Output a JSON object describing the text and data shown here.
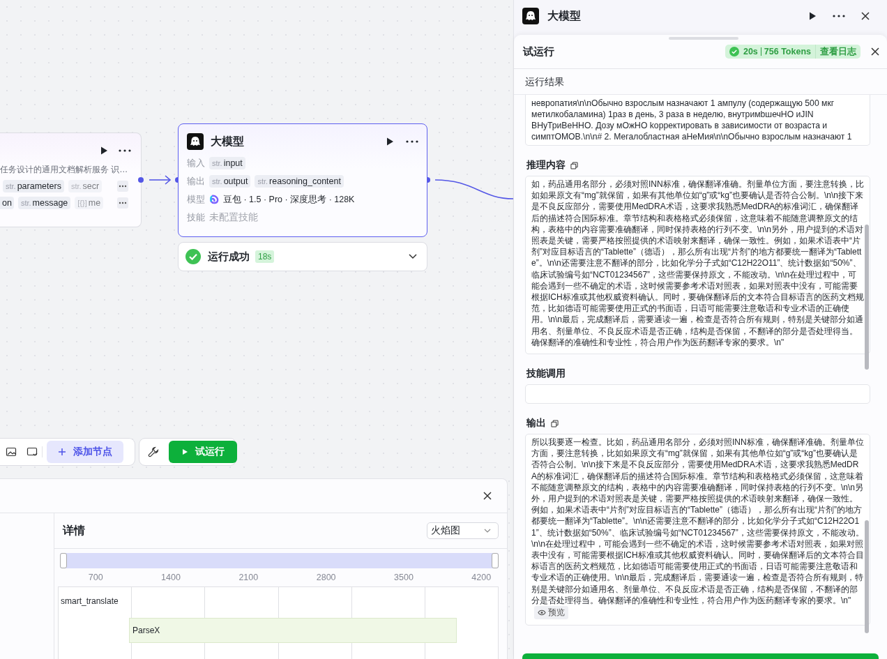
{
  "canvas": {
    "source_node": {
      "description": "任务设计的通用文档解析服务 识…",
      "port_rows": [
        [
          {
            "type": "str.",
            "name": "parameters",
            "faded": false
          },
          {
            "type": "str.",
            "name": "secr",
            "faded": true
          }
        ],
        [
          {
            "name": "on",
            "faded": false
          },
          {
            "type": "str.",
            "name": "message",
            "faded": false
          },
          {
            "type": "[{}]",
            "name": "me",
            "faded": true
          }
        ]
      ]
    },
    "llm_node": {
      "title": "大模型",
      "selected": true,
      "fields": [
        {
          "kind": "tags",
          "label": "输入",
          "tags": [
            {
              "type": "str.",
              "name": "input"
            }
          ]
        },
        {
          "kind": "tags",
          "label": "输出",
          "tags": [
            {
              "type": "str.",
              "name": "output"
            },
            {
              "type": "str.",
              "name": "reasoning_content"
            }
          ]
        },
        {
          "kind": "model",
          "label": "模型",
          "value": "豆包 · 1.5 · Pro · 深度思考 · 128K"
        },
        {
          "kind": "empty",
          "label": "技能",
          "value": "未配置技能"
        }
      ]
    },
    "run_status": {
      "text": "运行成功",
      "duration": "18s"
    },
    "toolbar": {
      "add_node": "添加节点",
      "test_run": "试运行"
    }
  },
  "trace_panel": {
    "title": "详情",
    "view_select": "火焰图",
    "range": {
      "level": 1
    },
    "ticks": [
      "700",
      "1400",
      "2100",
      "2800",
      "3500",
      "4200"
    ],
    "row_label": "smart_translate",
    "span_label": "ParseX"
  },
  "side_panel": {
    "title": "大模型",
    "test_run": {
      "title": "试运行",
      "time": "20s",
      "tokens": "756 Tokens",
      "log_link": "查看日志",
      "result_title": "运行结果",
      "result_lines": [
        "невропатия\\n\\nОбычно взрослым назначают 1 ампулу (содержащую 500 мкг",
        "метилкобаламина) 1раз в день, 3 раза в неделю, внутримbшечНО иJIN",
        "ВНуТриВеННО. Дозу мОжНО kорректировать в зависимости от возраста и",
        "симптОМОВ.\\n\\n# 2. Мегалобластная аНеМия\\n\\nОбычно взрослым назначают 1"
      ],
      "sections": [
        {
          "kind": "text",
          "title": "推理内容",
          "text": "如，药品通用名部分，必须对照INN标准，确保翻译准确。剂量单位方面，要注意转换，比如如果原文有“mg”就保留，如果有其他单位如“g”或“kg”也要确认是否符合公制。\\n\\n接下来是不良反应部分，需要使用MedDRA术语，这要求我熟悉MedDRA的标准词汇，确保翻译后的描述符合国际标准。章节结构和表格格式必须保留，这意味着不能随意调整原文的结构，表格中的内容需要准确翻译，同时保持表格的行列不变。\\n\\n另外，用户提到的术语对照表是关键，需要严格按照提供的术语映射来翻译，确保一致性。例如，如果术语表中“片剂”对应目标语言的“Tablette”（德语），那么所有出现“片剂”的地方都要统一翻译为“Tablette”。\\n\\n还需要注意不翻译的部分，比如化学分子式如“C12H22O11”、统计数据如“50%”、临床试验编号如“NCT01234567”，这些需要保持原文，不能改动。\\n\\n在处理过程中，可能会遇到一些不确定的术语，这时候需要参考术语对照表，如果对照表中没有，可能需要根据ICH标准或其他权威资料确认。同时，要确保翻译后的文本符合目标语言的医药文档规范，比如德语可能需要使用正式的书面语，日语可能需要注意敬语和专业术语的正确使用。\\n\\n最后，完成翻译后，需要通读一遍，检查是否符合所有规则，特别是关键部分如通用名、剂量单位、不良反应术语是否正确，结构是否保留，不翻译的部分是否处理得当。确保翻译的准确性和专业性，符合用户作为医药翻译专家的要求。\\n\""
        },
        {
          "kind": "empty",
          "title": "技能调用"
        },
        {
          "kind": "text",
          "title": "输出",
          "preview": "预览",
          "text": "所以我要逐一检查。比如，药品通用名部分，必须对照INN标准，确保翻译准确。剂量单位方面，要注意转换，比如如果原文有“mg”就保留，如果有其他单位如“g”或“kg”也要确认是否符合公制。\\n\\n接下来是不良反应部分，需要使用MedDRA术语，这要求我熟悉MedDRA的标准词汇，确保翻译后的描述符合国际标准。章节结构和表格格式必须保留，这意味着不能随意调整原文的结构，表格中的内容需要准确翻译，同时保持表格的行列不变。\\n\\n另外，用户提到的术语对照表是关键，需要严格按照提供的术语映射来翻译，确保一致性。例如，如果术语表中“片剂”对应目标语言的“Tablette”（德语），那么所有出现“片剂”的地方都要统一翻译为“Tablette”。\\n\\n还需要注意不翻译的部分，比如化学分子式如“C12H22O11”、统计数据如“50%”、临床试验编号如“NCT01234567”，这些需要保持原文，不能改动。\\n\\n在处理过程中，可能会遇到一些不确定的术语，这时候需要参考术语对照表，如果对照表中没有，可能需要根据ICH标准或其他权威资料确认。同时，要确保翻译后的文本符合目标语言的医药文档规范，比如德语可能需要使用正式的书面语，日语可能需要注意敬语和专业术语的正确使用。\\n\\n最后，完成翻译后，需要通读一遍，检查是否符合所有规则，特别是关键部分如通用名、剂量单位、不良反应术语是否正确，结构是否保留，不翻译的部分是否处理得当。确保翻译的准确性和专业性，符合用户作为医药翻译专家的要求。\\n\""
        }
      ]
    }
  }
}
